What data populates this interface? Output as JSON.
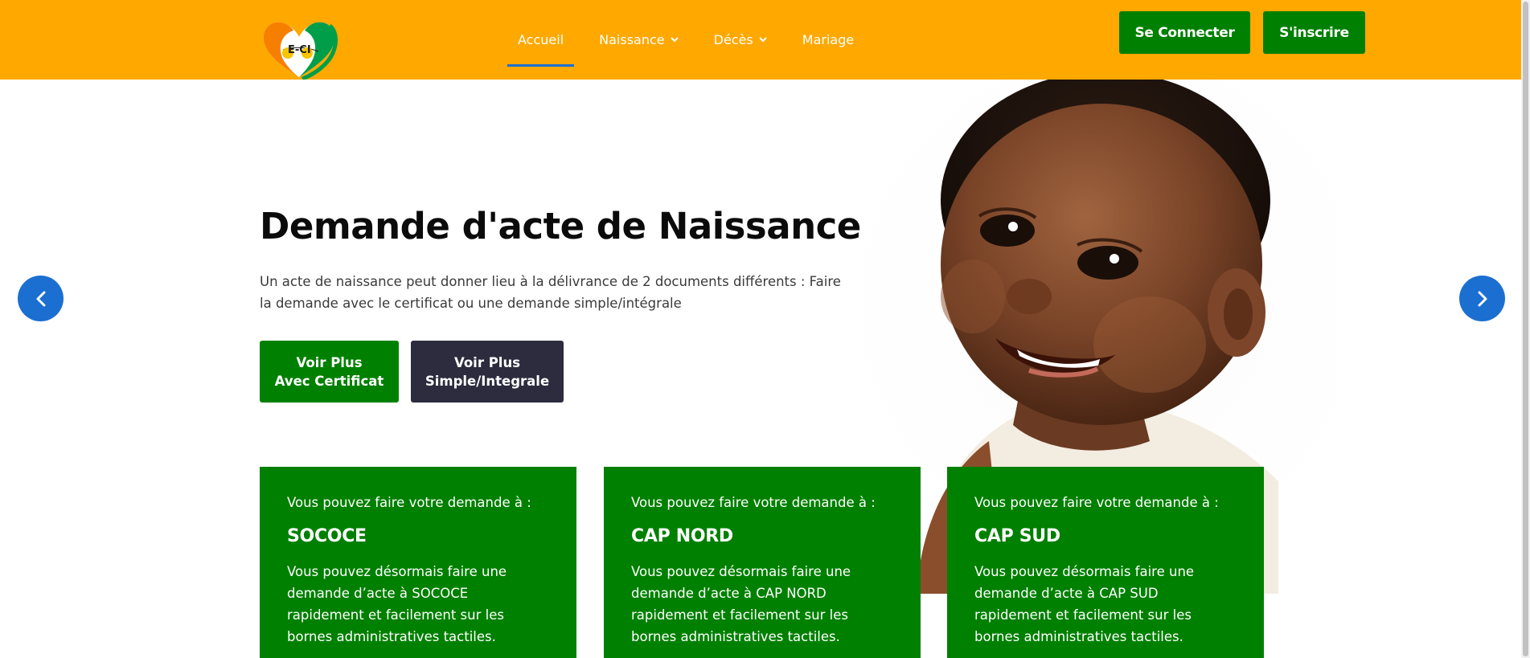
{
  "header": {
    "logo_text": "E-CI",
    "nav": [
      {
        "label": "Accueil",
        "active": true,
        "has_dropdown": false
      },
      {
        "label": "Naissance",
        "active": false,
        "has_dropdown": true
      },
      {
        "label": "Décès",
        "active": false,
        "has_dropdown": true
      },
      {
        "label": "Mariage",
        "active": false,
        "has_dropdown": false
      }
    ],
    "login_label": "Se Connecter",
    "signup_label": "S'inscrire"
  },
  "hero": {
    "title": "Demande d'acte de Naissance",
    "description": "Un acte de naissance peut donner lieu à la délivrance de 2 documents différents : Faire la demande avec le certificat ou une demande simple/intégrale",
    "btn_cert_line1": "Voir Plus",
    "btn_cert_line2": "Avec Certificat",
    "btn_simple_line1": "Voir Plus",
    "btn_simple_line2": "Simple/Integrale"
  },
  "cards": [
    {
      "intro": "Vous pouvez faire votre demande à :",
      "title": "SOCOCE",
      "text": "Vous pouvez désormais faire une demande d’acte à SOCOCE rapidement et facilement sur les bornes administratives tactiles."
    },
    {
      "intro": "Vous pouvez faire votre demande à :",
      "title": "CAP NORD",
      "text": "Vous pouvez désormais faire une demande d’acte à CAP NORD rapidement et facilement sur les bornes administratives tactiles."
    },
    {
      "intro": "Vous pouvez faire votre demande à :",
      "title": "CAP SUD",
      "text": "Vous pouvez désormais faire une demande d’acte à CAP SUD rapidement et facilement sur les bornes administratives tactiles."
    }
  ],
  "colors": {
    "header_bg": "#ffa800",
    "primary_green": "#008000",
    "dark_button": "#2c2c3e",
    "accent_blue": "#1b6fd1"
  },
  "icons": {
    "prev": "chevron-left-icon",
    "next": "chevron-right-icon",
    "dropdown": "chevron-down-icon"
  }
}
